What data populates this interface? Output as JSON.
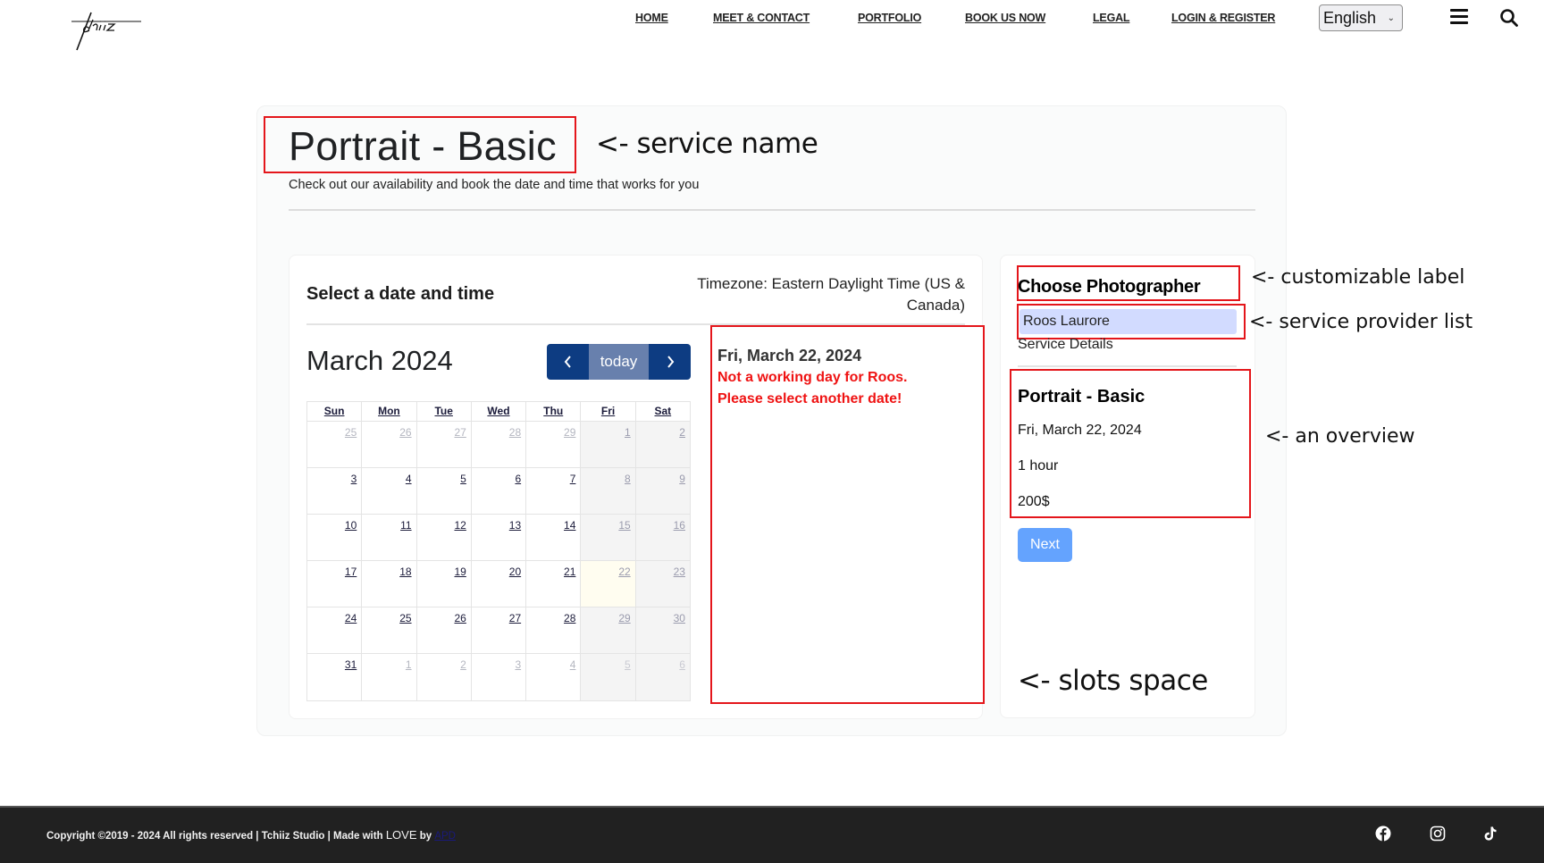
{
  "header": {
    "logo_text": "Tchiiz",
    "nav": [
      {
        "label": "HOME"
      },
      {
        "label": "MEET & CONTACT"
      },
      {
        "label": "PORTFOLIO"
      },
      {
        "label": "BOOK US NOW"
      },
      {
        "label": "LEGAL"
      },
      {
        "label": "LOGIN & REGISTER"
      }
    ],
    "language": "English",
    "menu_icon": "hamburger-icon",
    "search_icon": "search-icon"
  },
  "booking": {
    "service_name": "Portrait - Basic",
    "subtitle": "Check out our availability and book the date and time that works for you",
    "select_heading": "Select a date and time",
    "timezone": "Timezone: Eastern Daylight Time (US & Canada)",
    "calendar": {
      "month_title": "March 2024",
      "prev_icon": "chevron-left-icon",
      "today_label": "today",
      "next_icon": "chevron-right-icon",
      "weekdays": [
        "Sun",
        "Mon",
        "Tue",
        "Wed",
        "Thu",
        "Fri",
        "Sat"
      ],
      "weeks": [
        [
          {
            "d": "25",
            "t": "other"
          },
          {
            "d": "26",
            "t": "other"
          },
          {
            "d": "27",
            "t": "other"
          },
          {
            "d": "28",
            "t": "other"
          },
          {
            "d": "29",
            "t": "other"
          },
          {
            "d": "1",
            "t": "off"
          },
          {
            "d": "2",
            "t": "weekend"
          }
        ],
        [
          {
            "d": "3",
            "t": "day"
          },
          {
            "d": "4",
            "t": "day"
          },
          {
            "d": "5",
            "t": "day"
          },
          {
            "d": "6",
            "t": "day"
          },
          {
            "d": "7",
            "t": "day"
          },
          {
            "d": "8",
            "t": "off"
          },
          {
            "d": "9",
            "t": "off"
          }
        ],
        [
          {
            "d": "10",
            "t": "day"
          },
          {
            "d": "11",
            "t": "day"
          },
          {
            "d": "12",
            "t": "day"
          },
          {
            "d": "13",
            "t": "day"
          },
          {
            "d": "14",
            "t": "day"
          },
          {
            "d": "15",
            "t": "off"
          },
          {
            "d": "16",
            "t": "off"
          }
        ],
        [
          {
            "d": "17",
            "t": "day"
          },
          {
            "d": "18",
            "t": "day"
          },
          {
            "d": "19",
            "t": "day"
          },
          {
            "d": "20",
            "t": "day"
          },
          {
            "d": "21",
            "t": "day"
          },
          {
            "d": "22",
            "t": "selected"
          },
          {
            "d": "23",
            "t": "off"
          }
        ],
        [
          {
            "d": "24",
            "t": "day"
          },
          {
            "d": "25",
            "t": "day"
          },
          {
            "d": "26",
            "t": "day"
          },
          {
            "d": "27",
            "t": "day"
          },
          {
            "d": "28",
            "t": "day"
          },
          {
            "d": "29",
            "t": "off"
          },
          {
            "d": "30",
            "t": "off"
          }
        ],
        [
          {
            "d": "31",
            "t": "day"
          },
          {
            "d": "1",
            "t": "other"
          },
          {
            "d": "2",
            "t": "other"
          },
          {
            "d": "3",
            "t": "other"
          },
          {
            "d": "4",
            "t": "other"
          },
          {
            "d": "5",
            "t": "offother"
          },
          {
            "d": "6",
            "t": "offother"
          }
        ]
      ]
    },
    "slots": {
      "date": "Fri, March 22, 2024",
      "message_line1": "Not a working day for Roos.",
      "message_line2": "Please select another date!"
    },
    "sidebar": {
      "choose_label": "Choose Photographer",
      "providers": [
        "Roos Laurore"
      ],
      "service_details_label": "Service Details",
      "overview": {
        "title": "Portrait - Basic",
        "date": "Fri, March 22, 2024",
        "duration": "1 hour",
        "price": "200$"
      },
      "next_label": "Next"
    }
  },
  "annotations": {
    "service_name": "<- service name",
    "customizable_label": "<- customizable label",
    "provider_list": "<- service provider list",
    "overview": "<- an overview",
    "slots_space": "<- slots space"
  },
  "footer": {
    "copyright_prefix": "Copyright ©2019 - 2024 All rights reserved | Tchiiz Studio | Made with ",
    "love": "LOVE",
    "by": " by ",
    "author": "APD",
    "social": [
      "facebook-icon",
      "instagram-icon",
      "tiktok-icon"
    ]
  },
  "colors": {
    "accent_navy": "#0d3c82",
    "today_button": "#6880ad",
    "next_button": "#64a3fe",
    "provider_highlight": "#d2dbff",
    "error_red": "#ef1212",
    "annotation_red": "#e4161b",
    "footer_bg": "#212121"
  }
}
